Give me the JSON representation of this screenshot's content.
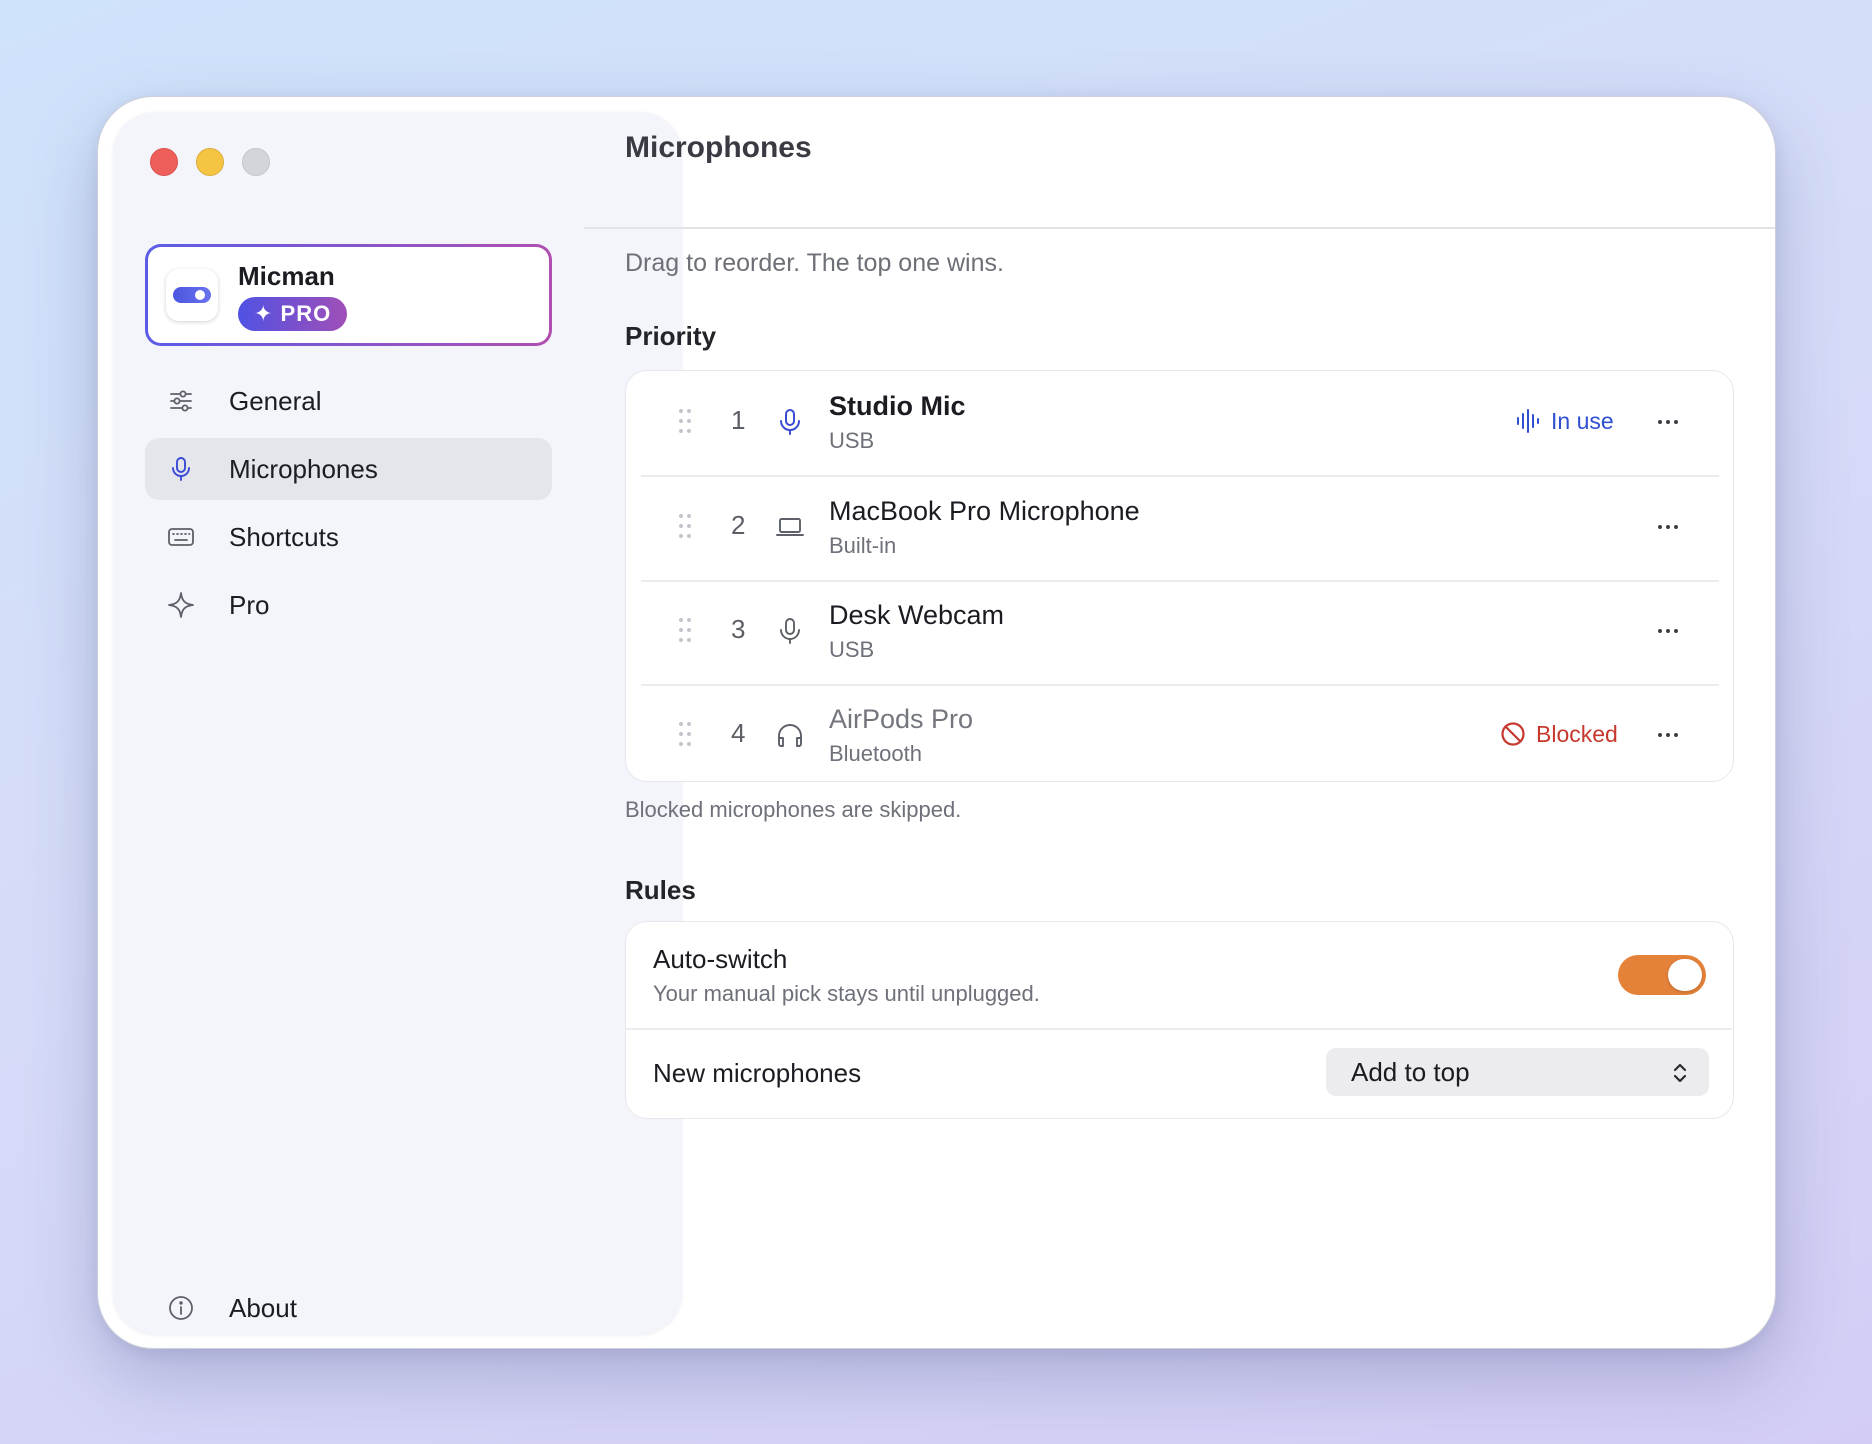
{
  "app": {
    "name": "Micman",
    "badge": "✦ PRO"
  },
  "sidebar": {
    "items": [
      {
        "label": "General",
        "icon": "sliders-icon"
      },
      {
        "label": "Microphones",
        "icon": "microphone-icon",
        "active": true
      },
      {
        "label": "Shortcuts",
        "icon": "keyboard-icon"
      },
      {
        "label": "Pro",
        "icon": "sparkle-icon"
      }
    ],
    "about": {
      "label": "About",
      "icon": "info-icon"
    }
  },
  "main": {
    "title": "Microphones",
    "subtitle": "Drag to reorder. The top one wins.",
    "priority_label": "Priority",
    "devices": [
      {
        "rank": "1",
        "name": "Studio Mic",
        "type": "USB",
        "icon": "microphone-icon",
        "status": "In use"
      },
      {
        "rank": "2",
        "name": "MacBook Pro Microphone",
        "type": "Built-in",
        "icon": "laptop-icon",
        "status": ""
      },
      {
        "rank": "3",
        "name": "Desk Webcam",
        "type": "USB",
        "icon": "microphone-icon",
        "status": ""
      },
      {
        "rank": "4",
        "name": "AirPods Pro",
        "type": "Bluetooth",
        "icon": "headphones-icon",
        "status": "Blocked"
      }
    ],
    "footnote": "Blocked microphones are skipped.",
    "rules_label": "Rules",
    "rules": {
      "auto_switch": {
        "title": "Auto-switch",
        "description": "Your manual pick stays until unplugged.",
        "enabled": true
      },
      "new_microphones": {
        "label": "New microphones",
        "value": "Add to top"
      }
    }
  },
  "colors": {
    "accent": "#4f52e3",
    "in_use": "#2f4fd1",
    "blocked": "#c6382d",
    "toggle_on": "#e4823a"
  }
}
